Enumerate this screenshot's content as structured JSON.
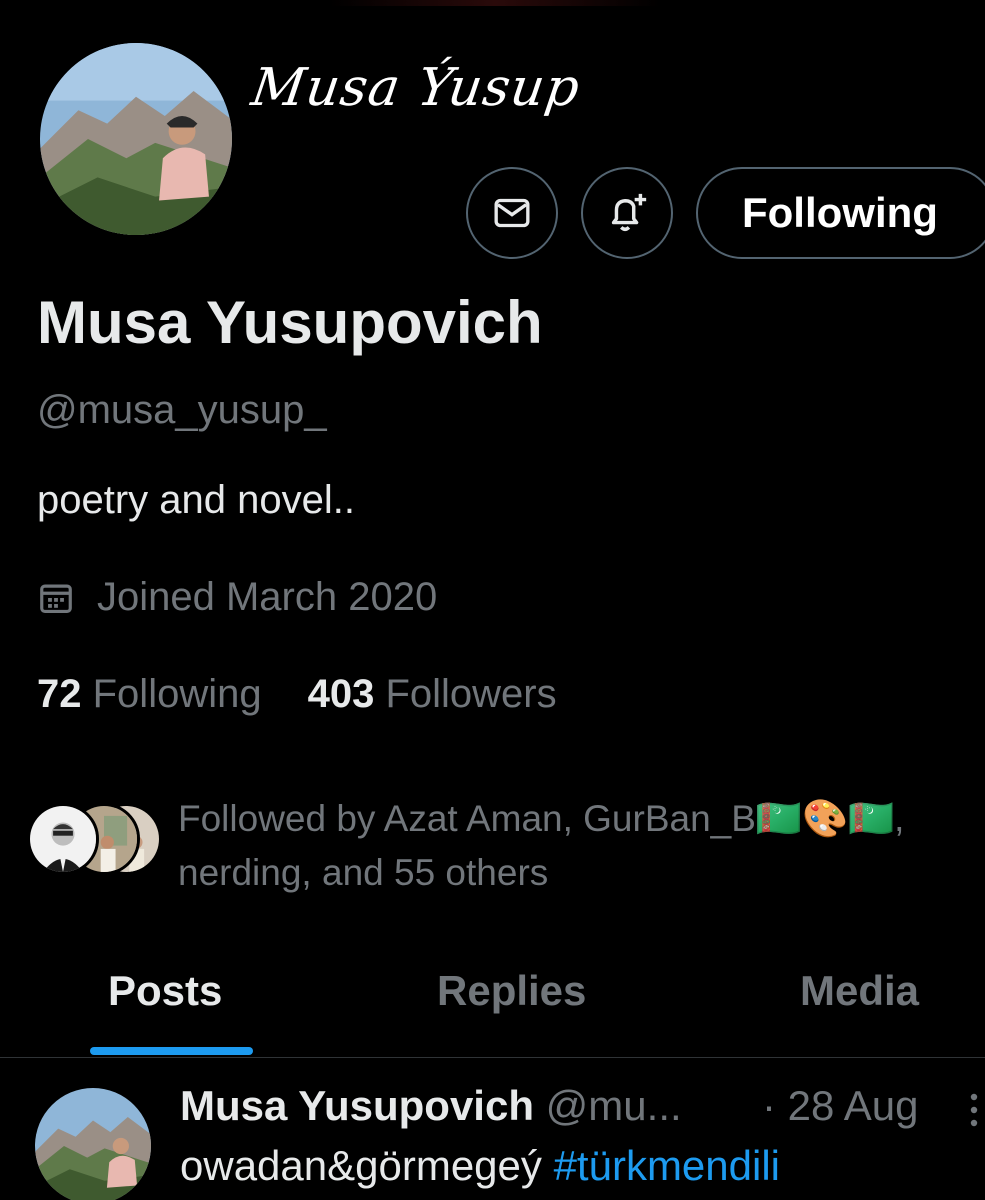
{
  "profile": {
    "banner_signature": "Musa Ýusup",
    "display_name": "Musa Yusupovich",
    "handle": "@musa_yusup_",
    "bio": "poetry and novel..",
    "joined": "Joined March 2020",
    "following_count": "72",
    "following_label": "Following",
    "followers_count": "403",
    "followers_label": "Followers",
    "followed_by_line1": "Followed by Azat Aman, GurBan_B🇹🇲🎨🇹🇲,",
    "followed_by_line2": "nerding, and 55 others"
  },
  "actions": {
    "follow_label": "Following",
    "message_icon": "envelope-icon",
    "notify_icon": "bell-plus-icon"
  },
  "tabs": [
    {
      "label": "Posts",
      "active": true
    },
    {
      "label": "Replies",
      "active": false
    },
    {
      "label": "Media",
      "active": false
    }
  ],
  "post": {
    "name": "Musa Yusupovich",
    "handle": "@mu...",
    "time": "· 28 Aug",
    "text": "owadan&görmegeý",
    "hashtag": "#türkmendili"
  },
  "colors": {
    "background": "#000000",
    "accent": "#1d9bf0",
    "text_primary": "#e7e9ea",
    "text_secondary": "#71767b",
    "border": "#536471"
  }
}
